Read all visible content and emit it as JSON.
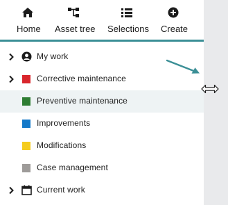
{
  "toolbar": {
    "items": [
      {
        "label": "Home",
        "icon": "home-icon"
      },
      {
        "label": "Asset tree",
        "icon": "asset-tree-icon"
      },
      {
        "label": "Selections",
        "icon": "list-icon"
      },
      {
        "label": "Create",
        "icon": "plus-circle-icon"
      }
    ],
    "accent_color": "#3b8f96"
  },
  "nav": {
    "items": [
      {
        "label": "My work",
        "icon": "user-circle-icon",
        "expandable": true
      },
      {
        "label": "Corrective maintenance",
        "color": "#d9262c",
        "expandable": true
      },
      {
        "label": "Preventive maintenance",
        "color": "#2e7d32",
        "expandable": false,
        "selected": true
      },
      {
        "label": "Improvements",
        "color": "#1479c9",
        "expandable": false
      },
      {
        "label": "Modifications",
        "color": "#f5cc1d",
        "expandable": false
      },
      {
        "label": "Case management",
        "color": "#9e9b99",
        "expandable": false
      },
      {
        "label": "Current work",
        "icon": "calendar-icon",
        "expandable": true
      }
    ]
  },
  "annotation": {
    "arrow_color": "#3b8f96",
    "cursor": "resize-horizontal-cursor-icon"
  }
}
